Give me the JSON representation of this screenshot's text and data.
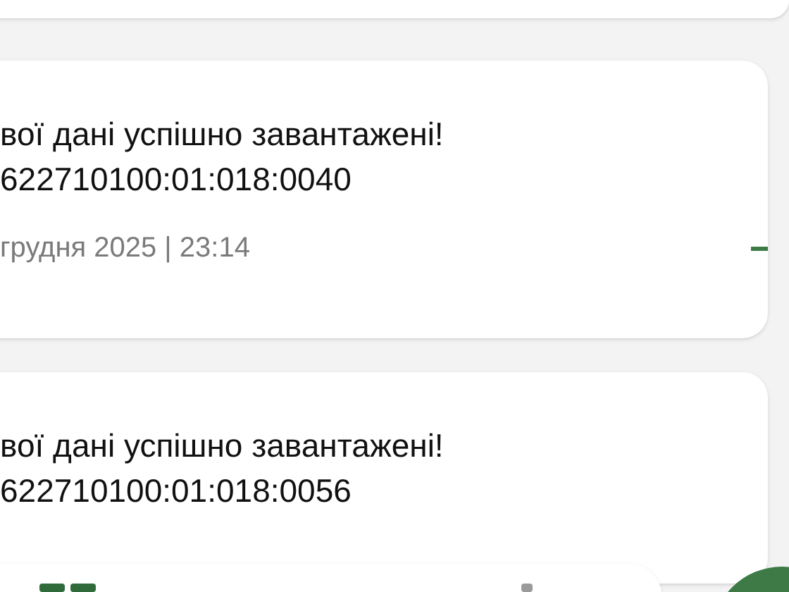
{
  "notifications": [
    {
      "title": "вої дані успішно завантажені!",
      "number": "622710100:01:018:0040",
      "date": "грудня 2025 | 23:14"
    },
    {
      "title": "вої дані успішно завантажені!",
      "number": "622710100:01:018:0056"
    }
  ]
}
